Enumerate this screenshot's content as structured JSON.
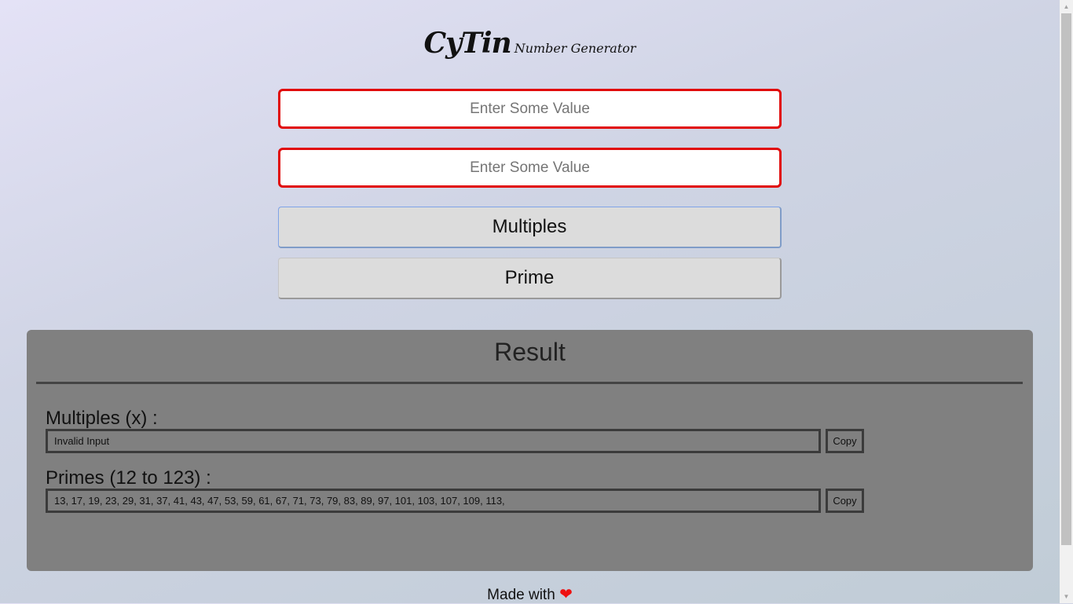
{
  "brand": {
    "name": "CyTin",
    "subtitle": "Number Generator"
  },
  "inputs": {
    "first": {
      "placeholder": "Enter Some Value",
      "value": ""
    },
    "second": {
      "placeholder": "Enter Some Value",
      "value": ""
    }
  },
  "buttons": {
    "multiples_label": "Multiples",
    "prime_label": "Prime"
  },
  "result": {
    "title": "Result",
    "multiples": {
      "label": "Multiples (x) :",
      "value": "Invalid Input",
      "copy_label": "Copy"
    },
    "primes": {
      "label": "Primes (12 to 123) :",
      "value": "13, 17, 19, 23, 29, 31, 37, 41, 43, 47, 53, 59, 61, 67, 71, 73, 79, 83, 89, 97, 101, 103, 107, 109, 113,",
      "copy_label": "Copy"
    }
  },
  "footer": {
    "text": "Made with",
    "icon": "heart-icon"
  },
  "colors": {
    "input_border": "#e10a0a",
    "panel_bg": "#808080",
    "heart": "#ee1111"
  }
}
